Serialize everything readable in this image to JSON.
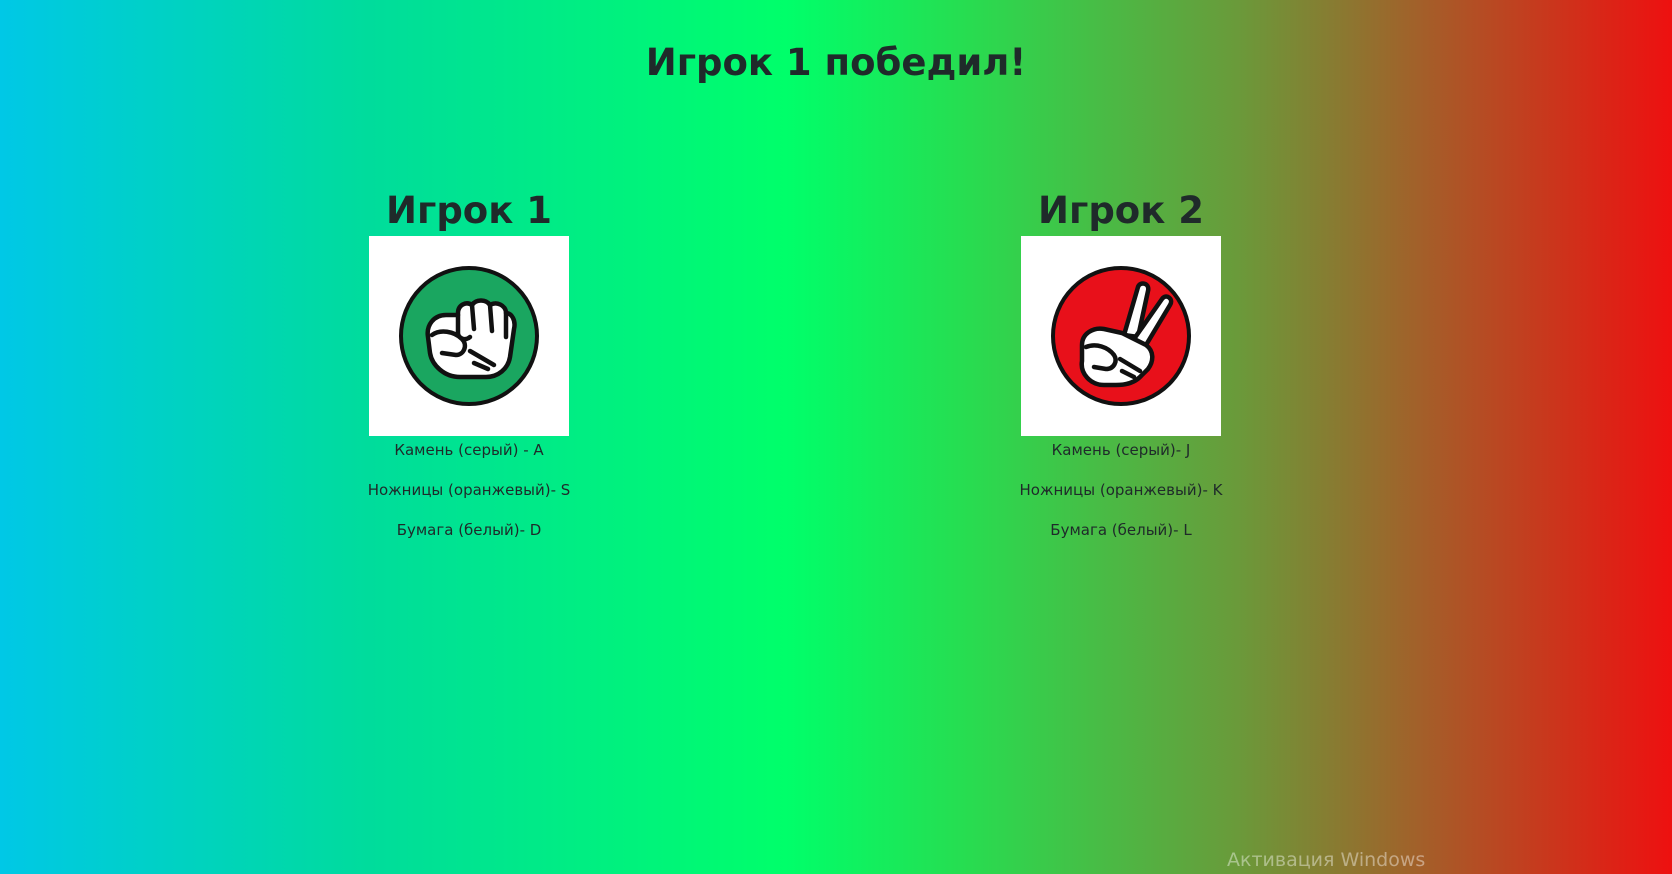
{
  "result": {
    "title": "Игрок 1 победил!"
  },
  "players": [
    {
      "name": "Игрок 1",
      "choice_icon": "rock-fist-icon",
      "choice_color": "#1aa660",
      "controls": [
        "Камень (серый) - A",
        "Ножницы (оранжевый)- S",
        "Бумага (белый)- D"
      ]
    },
    {
      "name": "Игрок 2",
      "choice_icon": "scissors-peace-icon",
      "choice_color": "#e8101a",
      "controls": [
        "Камень (серый)- J",
        "Ножницы (оранжевый)- K",
        "Бумага (белый)- L"
      ]
    }
  ],
  "system": {
    "watermark": "Активация Windows"
  },
  "colors": {
    "gradient_left": "#00c8e6",
    "gradient_mid": "#00ff6a",
    "gradient_right": "#ee1010",
    "text": "#1f2a2a"
  }
}
